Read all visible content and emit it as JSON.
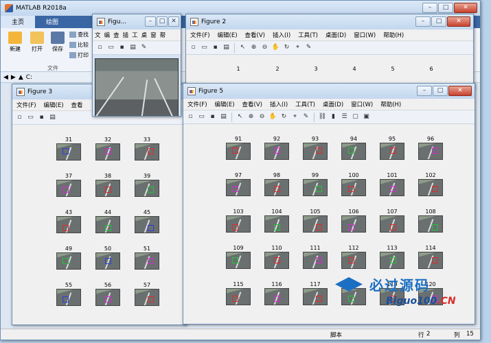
{
  "matlab": {
    "title": "MATLAB R2018a",
    "tabs": [
      "主页",
      "绘图"
    ],
    "ribbon": {
      "new": "新建",
      "open": "打开",
      "save": "保存",
      "find": "查找",
      "compare": "比较",
      "print": "打印",
      "group_file": "文件"
    },
    "path": "C:",
    "status": {
      "script": "脚本",
      "row_label": "行",
      "row": "2",
      "col_label": "列",
      "col": "15"
    }
  },
  "fig_small": {
    "title": "Figu...",
    "menu": [
      "文",
      "编",
      "查",
      "插",
      "工",
      "桌",
      "窗",
      "帮"
    ]
  },
  "fig2": {
    "title": "Figure 2",
    "menu": [
      "文件(F)",
      "编辑(E)",
      "查看(V)",
      "插入(I)",
      "工具(T)",
      "桌面(D)",
      "窗口(W)",
      "帮助(H)"
    ],
    "subplots": [
      "1",
      "2",
      "3",
      "4",
      "5",
      "6"
    ]
  },
  "fig3": {
    "title": "Figure 3",
    "menu": [
      "文件(F)",
      "编辑(E)",
      "查看"
    ],
    "rows": [
      [
        "31",
        "32",
        "33"
      ],
      [
        "37",
        "38",
        "39"
      ],
      [
        "43",
        "44",
        "45"
      ],
      [
        "49",
        "50",
        "51"
      ],
      [
        "55",
        "56",
        "57"
      ]
    ]
  },
  "fig5": {
    "title": "Figure 5",
    "menu": [
      "文件(F)",
      "编辑(E)",
      "查看(V)",
      "插入(I)",
      "工具(T)",
      "桌面(D)",
      "窗口(W)",
      "帮助(H)"
    ],
    "rows": [
      [
        "91",
        "92",
        "93",
        "94",
        "95",
        "96"
      ],
      [
        "97",
        "98",
        "99",
        "100",
        "101",
        "102"
      ],
      [
        "103",
        "104",
        "105",
        "106",
        "107",
        "108"
      ],
      [
        "109",
        "110",
        "111",
        "112",
        "113",
        "114"
      ],
      [
        "115",
        "116",
        "117",
        "118",
        "119",
        "120"
      ]
    ]
  },
  "watermark": {
    "line1": "必过源码",
    "line2a": "Biguo100",
    "line2b": ".CN"
  },
  "colors": {
    "titlebar": "#c3d7ee",
    "matlab_tab": "#3a66a3",
    "close": "#c8432e"
  }
}
